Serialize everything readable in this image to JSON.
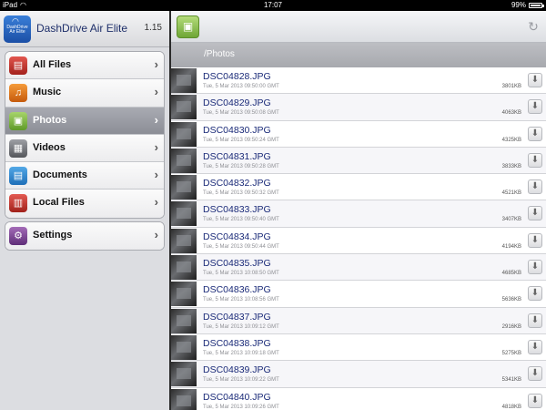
{
  "statusbar": {
    "carrier": "iPad",
    "time": "17:07",
    "battery": "99%",
    "battery_level": 0.99
  },
  "app": {
    "logo_text": "DashDrive Air Elite",
    "name": "DashDrive Air Elite",
    "version": "1.15"
  },
  "menu": {
    "items": [
      {
        "label": "All Files",
        "icon": "all-files-icon"
      },
      {
        "label": "Music",
        "icon": "music-icon"
      },
      {
        "label": "Photos",
        "icon": "photos-icon",
        "selected": true
      },
      {
        "label": "Videos",
        "icon": "videos-icon"
      },
      {
        "label": "Documents",
        "icon": "documents-icon"
      },
      {
        "label": "Local Files",
        "icon": "local-files-icon"
      }
    ],
    "settings": {
      "label": "Settings",
      "icon": "settings-icon"
    }
  },
  "main": {
    "path": "/Photos",
    "files": [
      {
        "name": "DSC04828.JPG",
        "date": "Tue, 5 Mar 2013 09:50:00 GMT",
        "size": "3801KB"
      },
      {
        "name": "DSC04829.JPG",
        "date": "Tue, 5 Mar 2013 09:50:08 GMT",
        "size": "4063KB"
      },
      {
        "name": "DSC04830.JPG",
        "date": "Tue, 5 Mar 2013 09:50:24 GMT",
        "size": "4325KB"
      },
      {
        "name": "DSC04831.JPG",
        "date": "Tue, 5 Mar 2013 09:50:28 GMT",
        "size": "3833KB"
      },
      {
        "name": "DSC04832.JPG",
        "date": "Tue, 5 Mar 2013 09:50:32 GMT",
        "size": "4521KB"
      },
      {
        "name": "DSC04833.JPG",
        "date": "Tue, 5 Mar 2013 09:50:40 GMT",
        "size": "3407KB"
      },
      {
        "name": "DSC04834.JPG",
        "date": "Tue, 5 Mar 2013 09:50:44 GMT",
        "size": "4194KB"
      },
      {
        "name": "DSC04835.JPG",
        "date": "Tue, 5 Mar 2013 10:08:50 GMT",
        "size": "4685KB"
      },
      {
        "name": "DSC04836.JPG",
        "date": "Tue, 5 Mar 2013 10:08:56 GMT",
        "size": "5636KB"
      },
      {
        "name": "DSC04837.JPG",
        "date": "Tue, 5 Mar 2013 10:09:12 GMT",
        "size": "2916KB"
      },
      {
        "name": "DSC04838.JPG",
        "date": "Tue, 5 Mar 2013 10:09:18 GMT",
        "size": "5275KB"
      },
      {
        "name": "DSC04839.JPG",
        "date": "Tue, 5 Mar 2013 10:09:22 GMT",
        "size": "5341KB"
      },
      {
        "name": "DSC04840.JPG",
        "date": "Tue, 5 Mar 2013 10:09:26 GMT",
        "size": "4818KB"
      }
    ]
  }
}
